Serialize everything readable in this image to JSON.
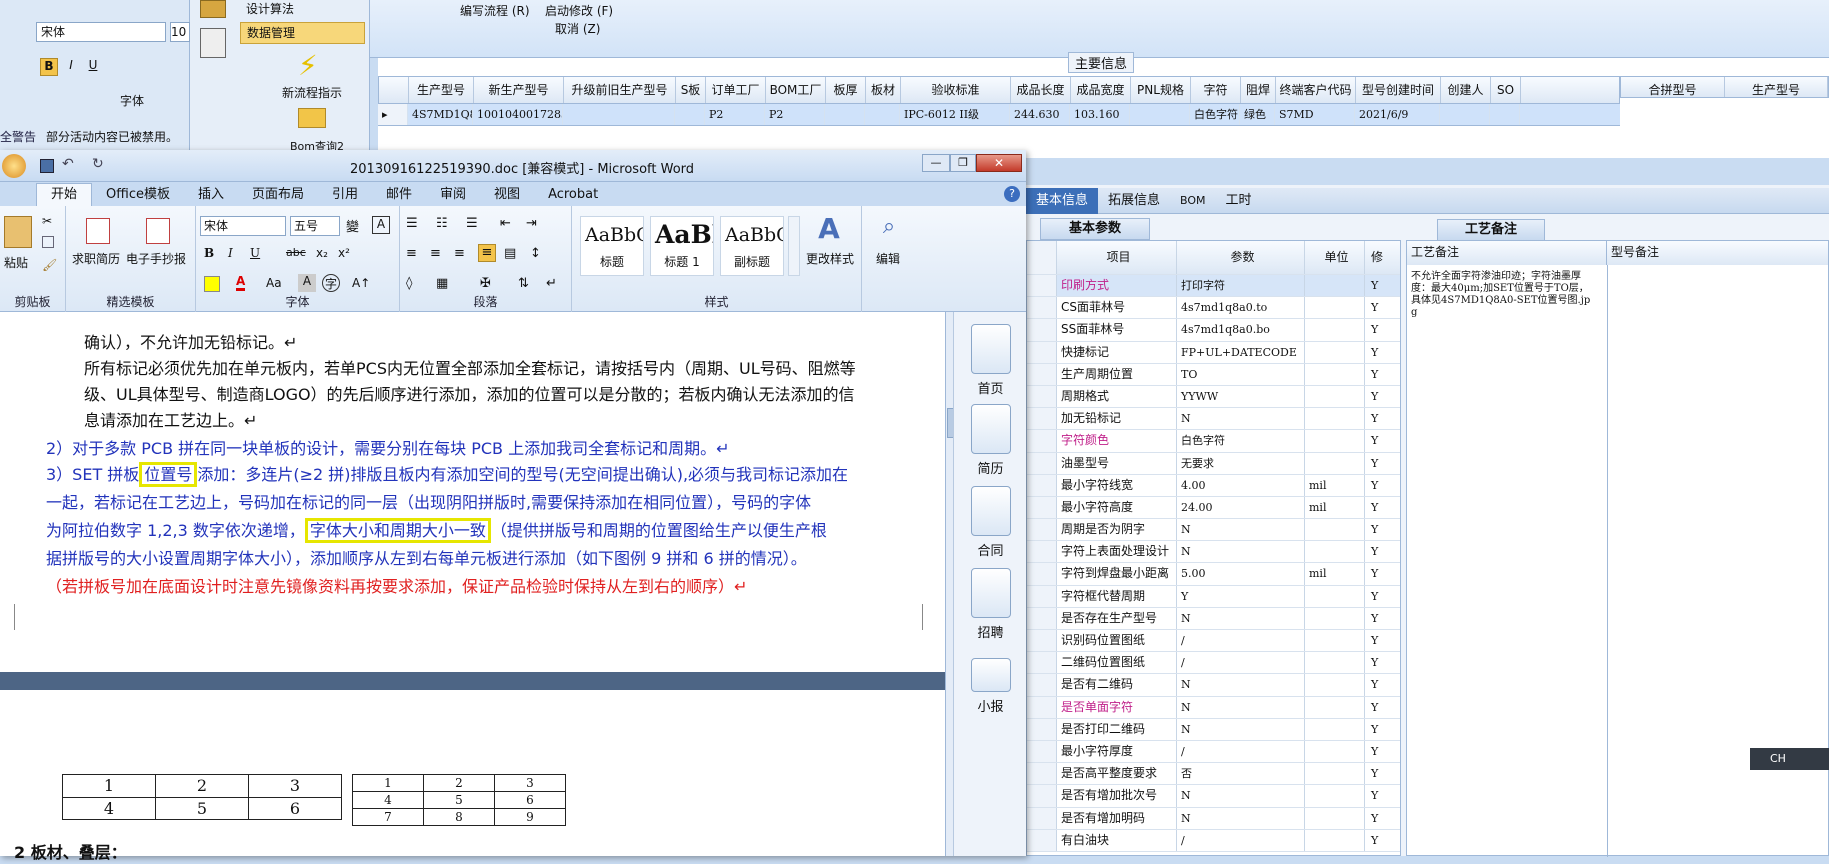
{
  "bg_app": {
    "left_panel": {
      "font_name": "宋体",
      "font_size": "10",
      "group_label": "字体",
      "warning_label": "全警告",
      "warning_text": "部分活动内容已被禁用。"
    },
    "nav": {
      "item1": "设计算法",
      "item2": "数据管理",
      "btn1": "新流程指示",
      "btn2": "Bom查询2"
    },
    "toolbar": {
      "edit_flow": "编写流程 (R)",
      "start_modify": "启动修改 (F)",
      "cancel": "取消 (Z)"
    },
    "main_info_label": "主要信息",
    "columns": [
      "生产型号",
      "新生产型号",
      "升级前旧生产型号",
      "S板",
      "订单工厂",
      "BOM工厂",
      "板厚",
      "板材",
      "验收标准",
      "成品长度",
      "成品宽度",
      "PNL规格",
      "字符",
      "阻焊",
      "终端客户代码",
      "型号创建时间",
      "创建人",
      "SO"
    ],
    "row": [
      "4S7MD1Q8A0",
      "10010400172833",
      "",
      "",
      "P2",
      "P2",
      "",
      "",
      "IPC-6012 II级",
      "244.630",
      "103.160",
      "",
      "白色字符",
      "绿色",
      "S7MD",
      "2021/6/9",
      "",
      ""
    ],
    "merge_columns": [
      "合拼型号",
      "生产型号"
    ],
    "tabs": [
      "基本信息",
      "拓展信息",
      "BOM",
      "工时"
    ],
    "params_tab": "基本参数",
    "params_headers": [
      "项目",
      "参数",
      "单位",
      "修"
    ],
    "params": [
      {
        "item": "印刷方式",
        "value": "打印字符",
        "unit": "",
        "flag": "Y"
      },
      {
        "item": "CS面菲林号",
        "value": "4s7md1q8a0.to",
        "unit": "",
        "flag": "Y"
      },
      {
        "item": "SS面菲林号",
        "value": "4s7md1q8a0.bo",
        "unit": "",
        "flag": "Y"
      },
      {
        "item": "快捷标记",
        "value": "FP+UL+DATECODE",
        "unit": "",
        "flag": "Y"
      },
      {
        "item": "生产周期位置",
        "value": "TO",
        "unit": "",
        "flag": "Y"
      },
      {
        "item": "周期格式",
        "value": "YYWW",
        "unit": "",
        "flag": "Y"
      },
      {
        "item": "加无铅标记",
        "value": "N",
        "unit": "",
        "flag": "Y"
      },
      {
        "item": "字符颜色",
        "value": "白色字符",
        "unit": "",
        "flag": "Y"
      },
      {
        "item": "油墨型号",
        "value": "无要求",
        "unit": "",
        "flag": "Y"
      },
      {
        "item": "最小字符线宽",
        "value": "4.00",
        "unit": "mil",
        "flag": "Y"
      },
      {
        "item": "最小字符高度",
        "value": "24.00",
        "unit": "mil",
        "flag": "Y"
      },
      {
        "item": "周期是否为阴字",
        "value": "N",
        "unit": "",
        "flag": "Y"
      },
      {
        "item": "字符上表面处理设计",
        "value": "N",
        "unit": "",
        "flag": "Y"
      },
      {
        "item": "字符到焊盘最小距离",
        "value": "5.00",
        "unit": "mil",
        "flag": "Y"
      },
      {
        "item": "字符框代替周期",
        "value": "Y",
        "unit": "",
        "flag": "Y"
      },
      {
        "item": "是否存在生产型号",
        "value": "N",
        "unit": "",
        "flag": "Y"
      },
      {
        "item": "识别码位置图纸",
        "value": "/",
        "unit": "",
        "flag": "Y"
      },
      {
        "item": "二维码位置图纸",
        "value": "/",
        "unit": "",
        "flag": "Y"
      },
      {
        "item": "是否有二维码",
        "value": "N",
        "unit": "",
        "flag": "Y"
      },
      {
        "item": "是否单面字符",
        "value": "N",
        "unit": "",
        "flag": "Y"
      },
      {
        "item": "是否打印二维码",
        "value": "N",
        "unit": "",
        "flag": "Y"
      },
      {
        "item": "最小字符厚度",
        "value": "/",
        "unit": "",
        "flag": "Y"
      },
      {
        "item": "是否高平整度要求",
        "value": "否",
        "unit": "",
        "flag": "Y"
      },
      {
        "item": "是否有增加批次号",
        "value": "N",
        "unit": "",
        "flag": "Y"
      },
      {
        "item": "是否有增加明码",
        "value": "N",
        "unit": "",
        "flag": "Y"
      },
      {
        "item": "有白油块",
        "value": "/",
        "unit": "",
        "flag": "Y"
      }
    ],
    "process_tab": "工艺备注",
    "process_header": "工艺备注",
    "model_header": "型号备注",
    "process_note": "不允许全面字符渗油印迹；字符油墨厚度：最大40μm;加SET位置号于TO层，具体见4S7MD1Q8A0-SET位置号图.jpg",
    "lang_indicator": "CH"
  },
  "word": {
    "title": "20130916122519390.doc [兼容模式] - Microsoft Word",
    "tabs": [
      "开始",
      "Office模板",
      "插入",
      "页面布局",
      "引用",
      "邮件",
      "审阅",
      "视图",
      "Acrobat"
    ],
    "groups": {
      "clipboard": "剪贴板",
      "template": "精选模板",
      "font": "字体",
      "paragraph": "段落",
      "styles": "样式"
    },
    "paste": "粘贴",
    "tpl1": "求职简历",
    "tpl2": "电子手抄报",
    "font_name": "宋体",
    "font_size": "五号",
    "style1": "标题",
    "style2": "标题 1",
    "style3": "副标题",
    "style_preview": "AaBbC",
    "style_preview2": "AaBl",
    "style_preview3": "AaBbC",
    "change_style": "更改样式",
    "edit": "编辑",
    "side": [
      "首页",
      "简历",
      "合同",
      "招聘",
      "小报"
    ]
  },
  "doc": {
    "l1": "确认），不允许加无铅标记。↵",
    "l2": "所有标记必须优先加在单元板内，若单PCS内无位置全部添加全套标记，请按括号内（周期、UL号码、阻燃等",
    "l3": "级、UL具体型号、制造商LOGO）的先后顺序进行添加，添加的位置可以是分散的；若板内确认无法添加的信",
    "l4": "息请添加在工艺边上。↵",
    "l5": "2）对于多款 PCB 拼在同一块单板的设计，需要分别在每块 PCB 上添加我司全套标记和周期。↵",
    "l6a": "3）SET 拼板",
    "l6hl": "位置号",
    "l6b": "添加：多连片(≥2 拼)排版且板内有添加空间的型号(无空间提出确认),必须与我司标记添加在",
    "l7": "一起，若标记在工艺边上，号码加在标记的同一层（出现阴阳拼版时,需要保持添加在相同位置），号码的字体",
    "l8a": "为阿拉伯数字  1,2,3  数字依次递增，",
    "l8hl": "字体大小和周期大小一致",
    "l8b": "（提供拼版号和周期的位置图给生产以便生产根",
    "l9": "据拼版号的大小设置周期字体大小），添加顺序从左到右每单元板进行添加（如下图例 9 拼和 6 拼的情况）。",
    "l10": "（若拼板号加在底面设计时注意先镜像资料再按要求添加，保证产品检验时保持从左到右的顺序）↵",
    "table1": [
      [
        "1",
        "2",
        "3"
      ],
      [
        "4",
        "5",
        "6"
      ]
    ],
    "table2": [
      [
        "1",
        "2",
        "3"
      ],
      [
        "4",
        "5",
        "6"
      ],
      [
        "7",
        "8",
        "9"
      ]
    ],
    "heading": "2    板材、叠层："
  }
}
